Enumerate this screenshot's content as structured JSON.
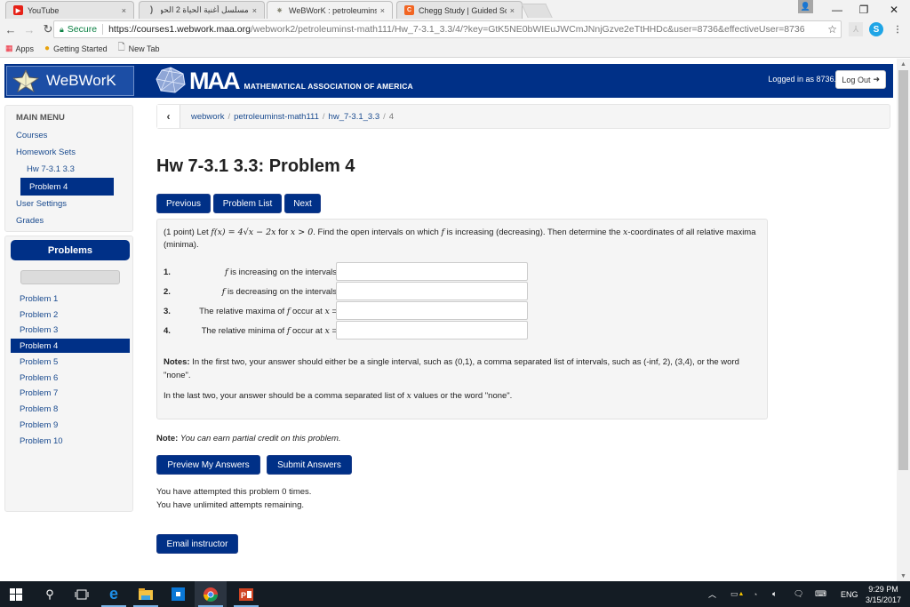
{
  "browser": {
    "tabs": [
      {
        "title": "YouTube",
        "icon": "youtube-icon",
        "active": false
      },
      {
        "title": "مسلسل أغنية الحياة 2 الحو",
        "icon": "loading-icon",
        "active": false
      },
      {
        "title": "WeBWorK : petroleumins",
        "icon": "webwork-icon",
        "active": true
      },
      {
        "title": "Chegg Study | Guided So",
        "icon": "chegg-icon",
        "active": false
      }
    ],
    "close_glyph": "×",
    "window_controls": {
      "minimize": "—",
      "restore": "❐",
      "close": "✕"
    },
    "address": {
      "secure_label": "Secure",
      "url_host": "https://courses1.webwork.maa.org",
      "url_path": "/webwork2/petroleuminst-math111/Hw_7-3.1_3.3/4/?key=GtK5NE0bWIEuJWCmJNnjGzve2eTtHHDc&user=8736&effectiveUser=8736"
    },
    "bookmarks": [
      {
        "label": "Apps",
        "icon": "apps-grid-icon"
      },
      {
        "label": "Getting Started",
        "icon": "chrome-icon"
      },
      {
        "label": "New Tab",
        "icon": "page-icon"
      }
    ]
  },
  "header": {
    "webwork_logo": "WeBWorK",
    "maa_logo": "MAA",
    "maa_subtitle": "MATHEMATICAL ASSOCIATION OF AMERICA",
    "logged_in": "Logged in as 8736.",
    "logout_label": "Log Out"
  },
  "main_menu": {
    "heading": "MAIN MENU",
    "items": [
      "Courses",
      "Homework Sets",
      "Hw 7-3.1 3.3",
      "Problem 4",
      "User Settings",
      "Grades"
    ],
    "active_item": "Problem 4"
  },
  "problems_panel": {
    "heading": "Problems",
    "items": [
      "Problem 1",
      "Problem 2",
      "Problem 3",
      "Problem 4",
      "Problem 5",
      "Problem 6",
      "Problem 7",
      "Problem 8",
      "Problem 9",
      "Problem 10"
    ],
    "active_index": 3
  },
  "breadcrumb": {
    "items": [
      "webwork",
      "petroleuminst-math111",
      "hw_7-3.1_3.3"
    ],
    "current": "4"
  },
  "page_title": "Hw 7-3.1 3.3: Problem 4",
  "nav_buttons": {
    "previous": "Previous",
    "problem_list": "Problem List",
    "next": "Next"
  },
  "problem": {
    "points": "(1 point) Let ",
    "function": "f(x) = 4√x − 2x",
    "for": " for ",
    "domain": "x > 0",
    "intro_rest": ". Find the open intervals on which ",
    "f": "f",
    "intro_rest2": " is increasing (decreasing). Then determine the ",
    "x": "x",
    "intro_rest3": "-coordinates of all relative maxima (minima).",
    "questions": [
      {
        "num": "1.",
        "pre": "",
        "post": " is increasing on the intervals",
        "value": ""
      },
      {
        "num": "2.",
        "pre": "",
        "post": " is decreasing on the intervals",
        "value": ""
      },
      {
        "num": "3.",
        "pre": "The relative maxima of ",
        "post": " occur at ",
        "value": ""
      },
      {
        "num": "4.",
        "pre": "The relative minima of ",
        "post": " occur at ",
        "value": ""
      }
    ],
    "notes_label": "Notes:",
    "notes_text": " In the first two, your answer should either be a single interval, such as (0,1), a comma separated list of intervals, such as (-inf, 2), (3,4), or the word \"none\".",
    "notes2_pre": "In the last two, your answer should be a comma separated list of ",
    "notes2_post": " values or the word \"none\"."
  },
  "partial_credit": {
    "label": "Note:",
    "text": "You can earn partial credit on this problem."
  },
  "actions": {
    "preview": "Preview My Answers",
    "submit": "Submit Answers",
    "email": "Email instructor"
  },
  "attempts": {
    "line1": "You have attempted this problem 0 times.",
    "line2": "You have unlimited attempts remaining."
  },
  "taskbar": {
    "apps": [
      "start-icon",
      "search-icon",
      "task-view-icon",
      "edge-icon",
      "file-explorer-icon",
      "store-icon",
      "chrome-icon",
      "powerpoint-icon"
    ],
    "language": "ENG",
    "time": "9:29 PM",
    "date": "3/15/2017"
  }
}
